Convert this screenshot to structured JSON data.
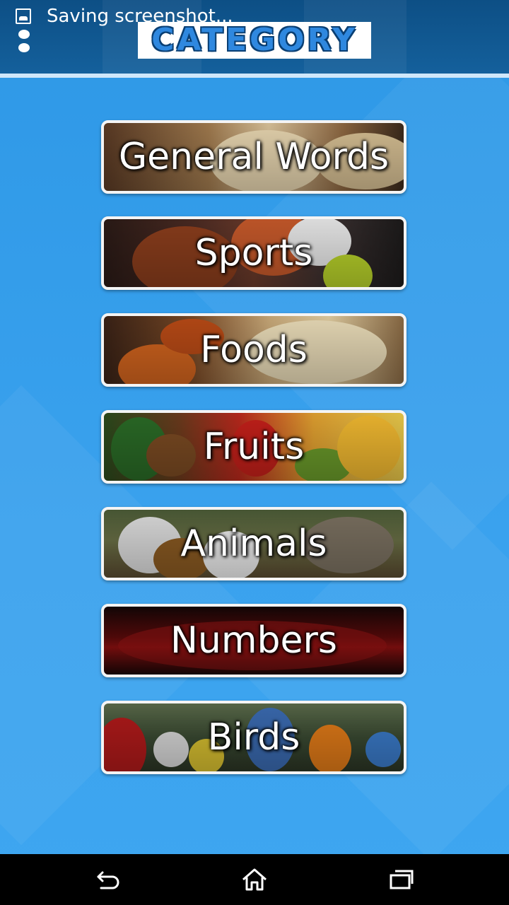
{
  "status": {
    "notification_text": "Saving screenshot..."
  },
  "header": {
    "title": "CATEGORY"
  },
  "categories": [
    {
      "label": "General Words"
    },
    {
      "label": "Sports"
    },
    {
      "label": "Foods"
    },
    {
      "label": "Fruits"
    },
    {
      "label": "Animals"
    },
    {
      "label": "Numbers"
    },
    {
      "label": "Birds"
    }
  ],
  "navbar": {
    "icons": [
      "back-icon",
      "home-icon",
      "recent-apps-icon"
    ]
  },
  "colors": {
    "background": "#2e9ae8",
    "header": "#0d4f85",
    "title_text": "#2f88df",
    "button_border": "#f4f4f4"
  }
}
